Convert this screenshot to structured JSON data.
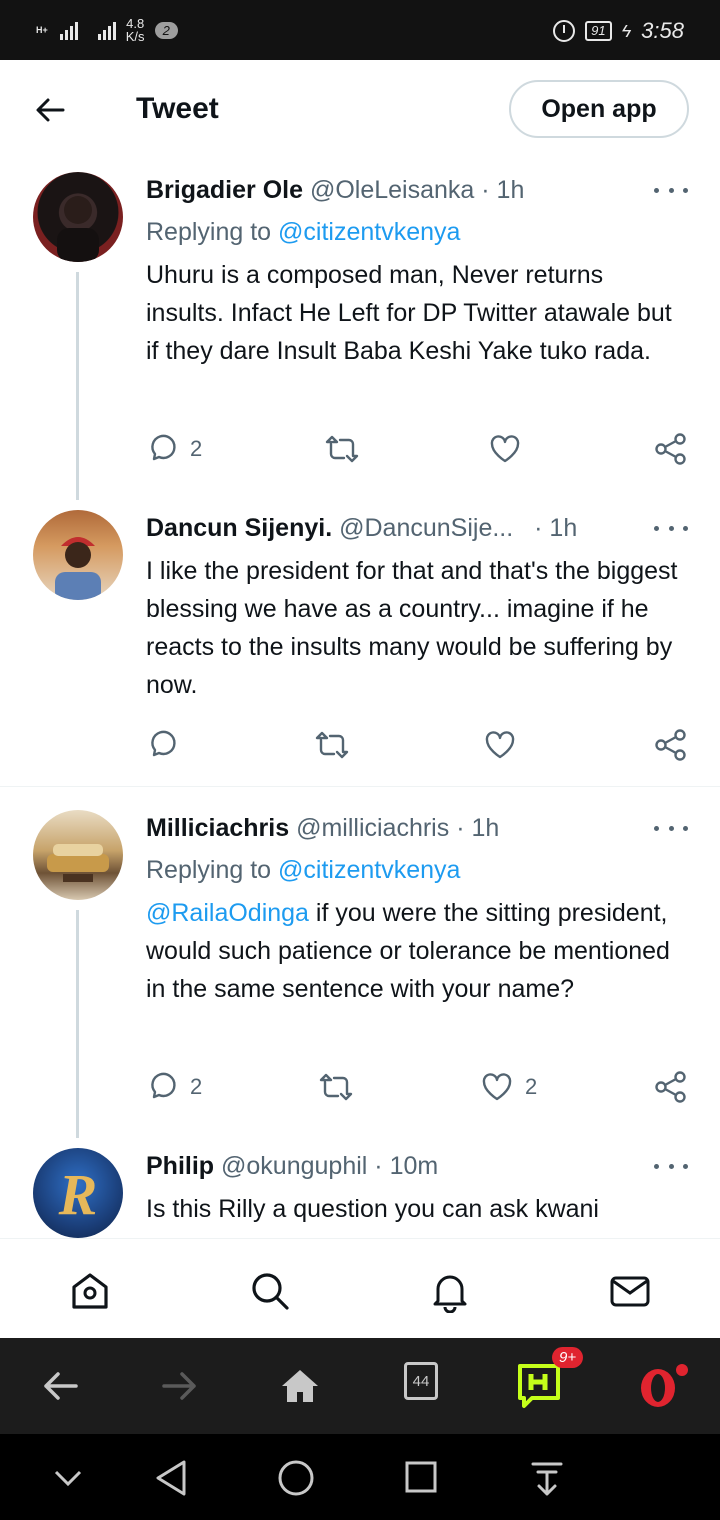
{
  "status_bar": {
    "network_label": "H+",
    "speed_value": "4.8",
    "speed_unit": "K/s",
    "notification_count": "2",
    "battery": "91",
    "time": "3:58"
  },
  "header": {
    "title": "Tweet",
    "open_app_label": "Open app"
  },
  "tweets": [
    {
      "name": "Brigadier Ole",
      "handle": "@OleLeisanka",
      "time": "· 1h",
      "replying_prefix": "Replying to",
      "replying_to": "@citizentvkenya",
      "text": "Uhuru is a composed man, Never returns insults. Infact He  Left for DP Twitter atawale but if they dare Insult Baba Keshi Yake tuko rada.",
      "replies": "2",
      "retweets": "",
      "likes": ""
    },
    {
      "name": "Dancun Sijenyi.",
      "handle": "@DancunSije...",
      "time": "· 1h",
      "text": "I like the president for that and that's the biggest blessing we have as a country... imagine if he reacts to the insults many would be suffering by now.",
      "replies": "",
      "retweets": "",
      "likes": ""
    },
    {
      "name": "Milliciachris",
      "handle": "@milliciachris",
      "time": "· 1h",
      "replying_prefix": "Replying to",
      "replying_to": "@citizentvkenya",
      "text_mention": "@RailaOdinga",
      "text": " if you were the sitting president, would such patience or tolerance be mentioned in the same sentence with your name?",
      "replies": "2",
      "retweets": "",
      "likes": "2"
    },
    {
      "name": "Philip",
      "handle": "@okunguphil",
      "time": "· 10m",
      "text": "Is this Rilly a question you can ask kwani"
    }
  ],
  "bottom_nav": {
    "icons": [
      "home-icon",
      "search-icon",
      "notifications-icon",
      "messages-icon"
    ]
  },
  "browser_bar": {
    "tabs_count": "44",
    "news_badge": "9+"
  },
  "colors": {
    "accent": "#1d9bf0",
    "text_primary": "#0f1419",
    "text_secondary": "#536471",
    "opera_red": "#e0242f",
    "hype_green": "#c5ff1a"
  }
}
